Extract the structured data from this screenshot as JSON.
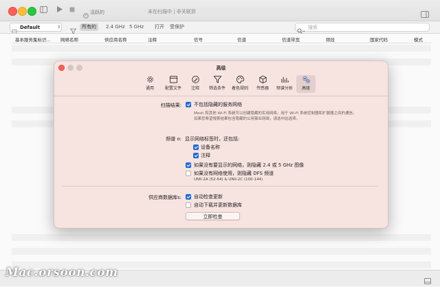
{
  "titlebar": {
    "status_text": "未在扫描中 | 非关联到",
    "activity_label": "活跃的"
  },
  "toolbar": {
    "profile_value": "Default",
    "filters": [
      "所有的",
      "2.4 GHz",
      "5 GHz",
      "打开",
      "受保护"
    ],
    "search_placeholder": "搜索"
  },
  "table": {
    "columns": [
      "基本服务集标识...",
      "网络名称",
      "供应商名称",
      "注释",
      "信号",
      "信道",
      "信道带宽",
      "频段",
      "国家代码",
      "模式"
    ]
  },
  "dialog": {
    "title": "高级",
    "tabs": [
      {
        "label": "通用",
        "icon": "gear-icon"
      },
      {
        "label": "配置文件",
        "icon": "window-icon"
      },
      {
        "label": "注释",
        "icon": "pencil-icon"
      },
      {
        "label": "筛选条件",
        "icon": "funnel-icon"
      },
      {
        "label": "着色规则",
        "icon": "palette-icon"
      },
      {
        "label": "传感器",
        "icon": "cube-icon"
      },
      {
        "label": "频谱分析",
        "icon": "bars-icon"
      },
      {
        "label": "高级",
        "icon": "gears-icon"
      }
    ],
    "scan": {
      "label": "扫描结果:",
      "hide_hidden_label": "不包括隐藏的服务网络",
      "hide_hidden_checked": true,
      "note_line1": "Mesh 和其他 Wi-Fi 系统可以创建隐藏的实用网络，用于 Wi-Fi 系统控制器和扩展器之间的通信。",
      "note_line2": "如果您希望搜索结果包含隐藏的公用事业网络，请选中此选项。"
    },
    "spectrum": {
      "label": "频谱 o:",
      "intro": "显示网络标签时，还包括:",
      "device_name_label": "设备名称",
      "device_name_checked": true,
      "comment_label": "注释",
      "comment_checked": true,
      "hide_24_5_label": "如果没有要显示的网络，则隐藏 2.4 或 5 GHz 图像",
      "hide_24_5_checked": true,
      "hide_dfs_label": "如果没有网络使用，则隐藏 DFS 频道",
      "hide_dfs_checked": false,
      "dfs_sub": "UNII-2A (52-64) & UNII-2C (100-144)"
    },
    "vendor": {
      "label": "供应商数据库s:",
      "auto_check_label": "自动检查更新",
      "auto_check_checked": true,
      "auto_download_label": "自动下载并更新数据库",
      "auto_download_checked": false,
      "check_now_label": "立即检查"
    }
  },
  "watermark": "Mac.orsoon.com"
}
